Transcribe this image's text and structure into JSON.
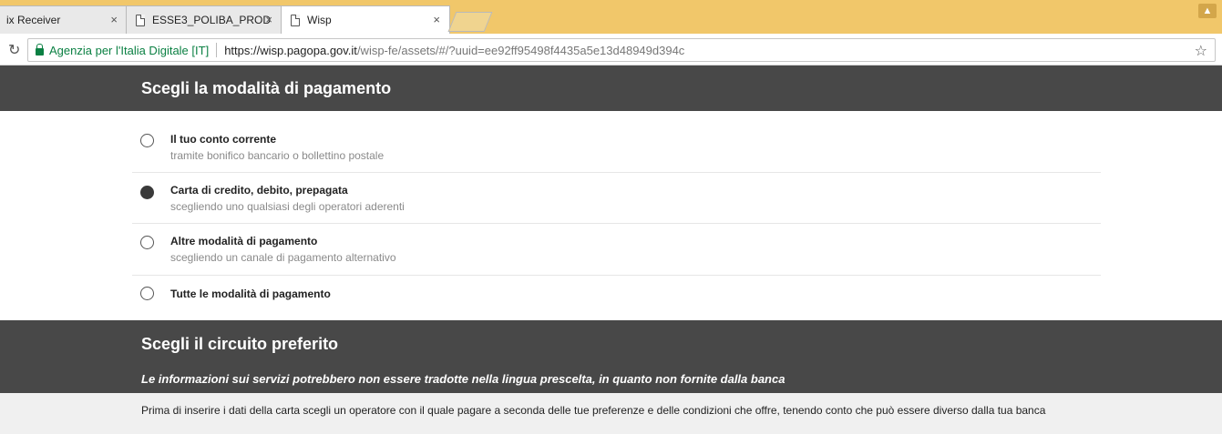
{
  "browser": {
    "tabs": [
      {
        "title": "ix Receiver",
        "active": false
      },
      {
        "title": "ESSE3_POLIBA_PROD",
        "active": false
      },
      {
        "title": "Wisp",
        "active": true
      }
    ],
    "close_glyph": "×",
    "address": {
      "site_identity": "Agenzia per l'Italia Digitale [IT]",
      "url_host": "https://wisp.pagopa.gov.it",
      "url_path": "/wisp-fe/assets/#/?uuid=ee92ff95498f4435a5e13d48949d394c"
    },
    "accent_color": "#f1c76a"
  },
  "payment_section": {
    "title": "Scegli la modalità di pagamento",
    "options": [
      {
        "title": "Il tuo conto corrente",
        "subtitle": "tramite bonifico bancario o bollettino postale",
        "selected": false
      },
      {
        "title": "Carta di credito, debito, prepagata",
        "subtitle": "scegliendo uno qualsiasi degli operatori aderenti",
        "selected": true
      },
      {
        "title": "Altre modalità di pagamento",
        "subtitle": "scegliendo un canale di pagamento alternativo",
        "selected": false
      },
      {
        "title": "Tutte le modalità di pagamento",
        "subtitle": "",
        "selected": false
      }
    ]
  },
  "circuit_section": {
    "title": "Scegli il circuito preferito",
    "note": "Le informazioni sui servizi potrebbero non essere tradotte nella lingua prescelta, in quanto non fornite dalla banca",
    "info": "Prima di inserire i dati della carta scegli un operatore con il quale pagare a seconda delle tue preferenze e delle condizioni che offre, tenendo conto che può essere diverso dalla tua banca"
  }
}
